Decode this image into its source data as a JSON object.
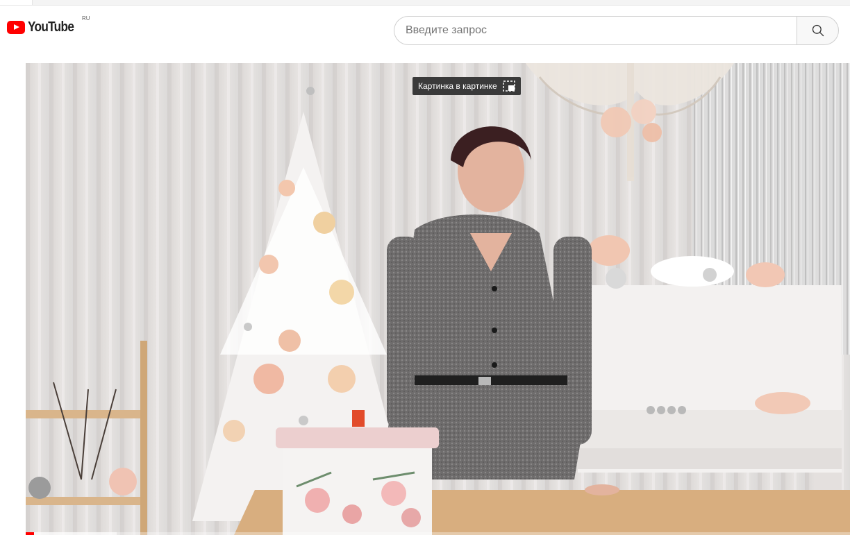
{
  "header": {
    "logo_text": "YouTube",
    "country_code": "RU"
  },
  "search": {
    "placeholder": "Введите запрос",
    "value": ""
  },
  "icons": {
    "search": "search-icon",
    "pip": "picture-in-picture-icon"
  },
  "player": {
    "pip_tooltip": "Картинка в картинке",
    "progress_played": 0.01,
    "progress_loaded": 0.11
  },
  "colors": {
    "brand_red": "#ff0000",
    "text": "#212121"
  }
}
